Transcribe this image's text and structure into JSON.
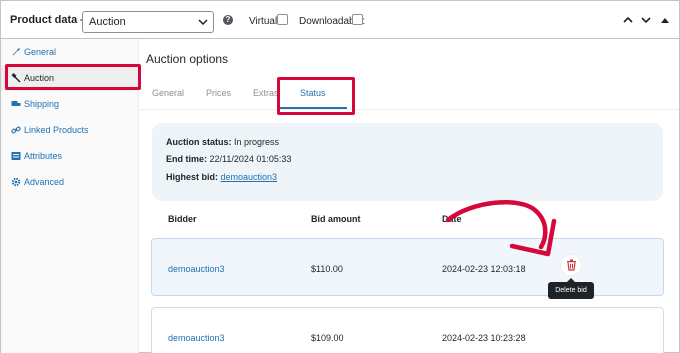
{
  "header": {
    "title": "Product data —",
    "product_type": "Auction",
    "virtual_label": "Virtual:",
    "downloadable_label": "Downloadable:"
  },
  "sidebar": {
    "items": [
      {
        "label": "General",
        "icon": "wrench-icon"
      },
      {
        "label": "Auction",
        "icon": "gavel-icon"
      },
      {
        "label": "Shipping",
        "icon": "truck-icon"
      },
      {
        "label": "Linked Products",
        "icon": "link-icon"
      },
      {
        "label": "Attributes",
        "icon": "list-icon"
      },
      {
        "label": "Advanced",
        "icon": "gear-icon"
      }
    ]
  },
  "main": {
    "title": "Auction options",
    "tabs": [
      {
        "label": "General"
      },
      {
        "label": "Prices"
      },
      {
        "label": "Extras"
      },
      {
        "label": "Status"
      }
    ]
  },
  "status": {
    "auction_status_label": "Auction status:",
    "auction_status_value": "In progress",
    "end_time_label": "End time:",
    "end_time_value": "22/11/2024 01:05:33",
    "highest_bid_label": "Highest bid:",
    "highest_bid_value": "demoauction3"
  },
  "table": {
    "headers": [
      "Bidder",
      "Bid amount",
      "Date"
    ],
    "rows": [
      {
        "bidder": "demoauction3",
        "amount": "$110.00",
        "date": "2024-02-23 12:03:18"
      },
      {
        "bidder": "demoauction3",
        "amount": "$109.00",
        "date": "2024-02-23 10:23:28"
      }
    ]
  },
  "tooltip": "Delete bid",
  "colors": {
    "highlight": "#d6083b",
    "link": "#2271b1"
  }
}
